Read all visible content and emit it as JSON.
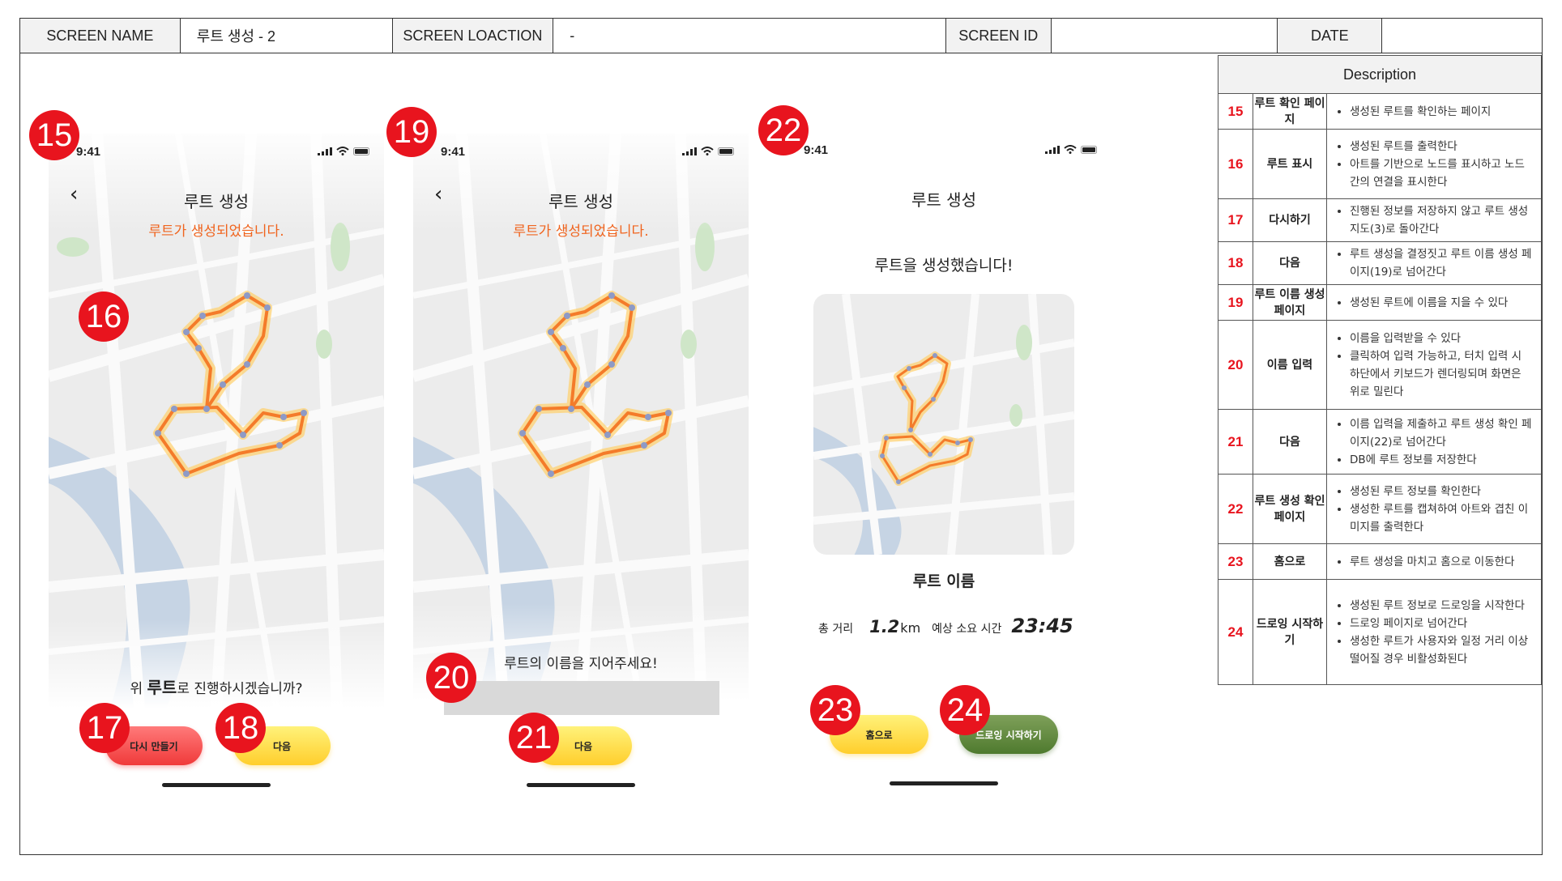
{
  "header": {
    "screen_name_label": "SCREEN NAME",
    "screen_name_value": "루트 생성 - 2",
    "screen_location_label": "SCREEN LOACTION",
    "screen_location_value": "-",
    "screen_id_label": "SCREEN ID",
    "screen_id_value": "",
    "date_label": "DATE",
    "date_value": ""
  },
  "phone1": {
    "time": "9:41",
    "back": "‹",
    "title": "루트 생성",
    "alert": "루트가 생성되었습니다.",
    "question_pre": "위 ",
    "question_bold": "루트",
    "question_post": "로 진행하시겠습니까?",
    "btn_retry": "다시 만들기",
    "btn_next": "다음"
  },
  "phone2": {
    "time": "9:41",
    "back": "‹",
    "title": "루트 생성",
    "alert": "루트가 생성되었습니다.",
    "name_prompt": "루트의 이름을 지어주세요!",
    "name_input_value": "",
    "btn_next": "다음"
  },
  "phone3": {
    "time": "9:41",
    "title": "루트 생성",
    "done_msg": "루트을 생성했습니다!",
    "route_name": "루트 이름",
    "distance_label": "총 거리",
    "distance_value": "1.2",
    "distance_unit": "km",
    "time_label": "예상 소요 시간",
    "time_value": "23:45",
    "btn_home": "홈으로",
    "btn_start": "드로잉 시작하기"
  },
  "badges": [
    "15",
    "16",
    "17",
    "18",
    "19",
    "20",
    "21",
    "22",
    "23",
    "24"
  ],
  "description": {
    "title": "Description",
    "rows": [
      {
        "num": "15",
        "name": "루트 확인 페이지",
        "items": [
          "생성된 루트를 확인하는 페이지"
        ]
      },
      {
        "num": "16",
        "name": "루트 표시",
        "items": [
          "생성된 루트를 출력한다",
          "아트를 기반으로 노드를 표시하고 노드간의 연결을 표시한다"
        ]
      },
      {
        "num": "17",
        "name": "다시하기",
        "items": [
          "진행된 정보를 저장하지 않고 루트 생성 지도(3)로 돌아간다"
        ]
      },
      {
        "num": "18",
        "name": "다음",
        "items": [
          "루트 생성을 결정짓고 루트 이름 생성 페이지(19)로 넘어간다"
        ]
      },
      {
        "num": "19",
        "name": "루트 이름 생성 페이지",
        "items": [
          "생성된 루트에 이름을 지을 수 있다"
        ]
      },
      {
        "num": "20",
        "name": "이름 입력",
        "items": [
          "이름을 입력받을 수 있다",
          "클릭하여 입력 가능하고, 터치 입력 시 하단에서 키보드가 렌더링되며 화면은 위로 밀린다"
        ]
      },
      {
        "num": "21",
        "name": "다음",
        "items": [
          "이름 입력을 제출하고 루트 생성 확인 페이지(22)로 넘어간다",
          "DB에 루트 정보를 저장한다"
        ]
      },
      {
        "num": "22",
        "name": "루트 생성 확인 페이지",
        "items": [
          "생성된 루트 정보를 확인한다",
          "생성한 루트를 캡쳐하여 아트와 겹친 이미지를 출력한다"
        ]
      },
      {
        "num": "23",
        "name": "홈으로",
        "items": [
          "루트 생성을 마치고 홈으로 이동한다"
        ]
      },
      {
        "num": "24",
        "name": "드로잉 시작하기",
        "items": [
          "생성된 루트 정보로 드로잉을 시작한다",
          "드로잉 페이지로 넘어간다",
          "생성한 루트가 사용자와 일정 거리 이상 떨어질 경우 비활성화된다"
        ]
      }
    ]
  }
}
